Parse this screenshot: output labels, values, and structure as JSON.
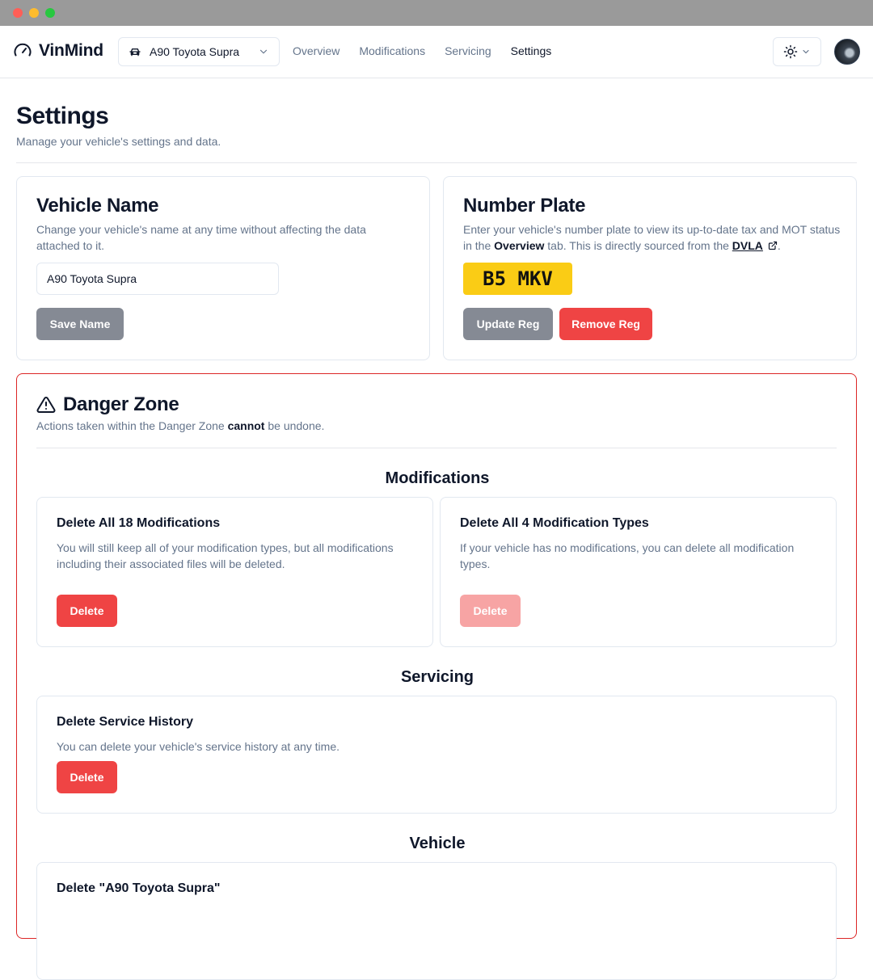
{
  "app": {
    "brand": "VinMind",
    "vehicle_selector": {
      "label": "A90 Toyota Supra"
    },
    "nav": [
      {
        "label": "Overview"
      },
      {
        "label": "Modifications"
      },
      {
        "label": "Servicing"
      },
      {
        "label": "Settings",
        "active": true
      }
    ]
  },
  "page": {
    "title": "Settings",
    "subtitle": "Manage your vehicle's settings and data."
  },
  "vehicle_name": {
    "title": "Vehicle Name",
    "description": "Change your vehicle's name at any time without affecting the data attached to it.",
    "input_value": "A90 Toyota Supra",
    "save_label": "Save Name"
  },
  "number_plate": {
    "title": "Number Plate",
    "description_pre": "Enter your vehicle's number plate to view its up-to-date tax and MOT status in the ",
    "description_bold": "Overview",
    "description_mid": " tab. This is directly sourced from the ",
    "description_link": "DVLA",
    "description_post": ".",
    "plate": "B5 MKV",
    "update_label": "Update Reg",
    "remove_label": "Remove Reg"
  },
  "danger_zone": {
    "title": "Danger Zone",
    "desc_pre": "Actions taken within the Danger Zone ",
    "desc_bold": "cannot",
    "desc_post": " be undone.",
    "sections": {
      "modifications": {
        "heading": "Modifications",
        "delete_all": {
          "title": "Delete All 18 Modifications",
          "description": "You will still keep all of your modification types, but all modifications including their associated files will be deleted.",
          "button": "Delete"
        },
        "delete_types": {
          "title": "Delete All 4 Modification Types",
          "description": "If your vehicle has no modifications, you can delete all modification types.",
          "button": "Delete"
        }
      },
      "servicing": {
        "heading": "Servicing",
        "delete_history": {
          "title": "Delete Service History",
          "description": "You can delete your vehicle's service history at any time.",
          "button": "Delete"
        }
      },
      "vehicle": {
        "heading": "Vehicle",
        "delete_vehicle": {
          "title_pre": "Delete \"",
          "title_bold": "A90 Toyota Supra",
          "title_post": "\""
        }
      }
    }
  },
  "colors": {
    "danger": "#ef4444",
    "danger_border": "#dc2626",
    "plate": "#facc15",
    "muted": "#64748b"
  }
}
